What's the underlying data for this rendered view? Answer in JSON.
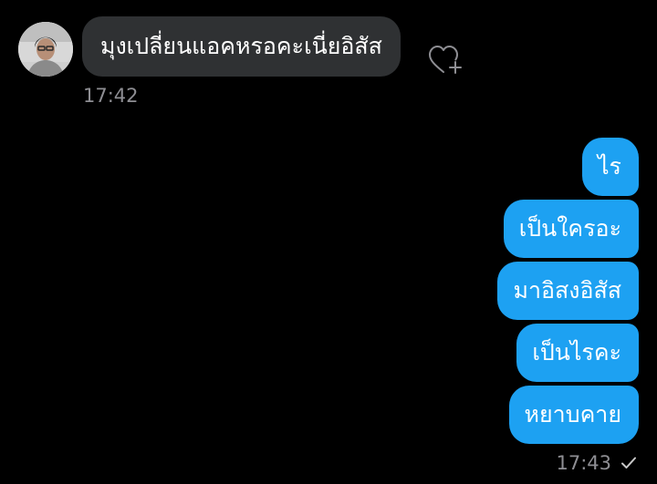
{
  "conversation": {
    "incoming": {
      "avatar_icon": "user-avatar-photo",
      "message": "มุงเปลี่ยนแอคหรอคะเนี่ยอิสัส",
      "time": "17:42",
      "react_icon": "heart-plus-icon"
    },
    "outgoing": {
      "messages": [
        {
          "text": "ไร"
        },
        {
          "text": "เป็นใครอะ"
        },
        {
          "text": "มาอิสงอิสัส"
        },
        {
          "text": "เป็นไรคะ"
        },
        {
          "text": "หยาบคาย"
        }
      ],
      "time": "17:43",
      "status_icon": "checkmark-icon"
    }
  },
  "colors": {
    "background": "#000000",
    "incoming_bubble": "#2f3133",
    "outgoing_bubble": "#1da1f2",
    "timestamp": "#8e8e93"
  }
}
